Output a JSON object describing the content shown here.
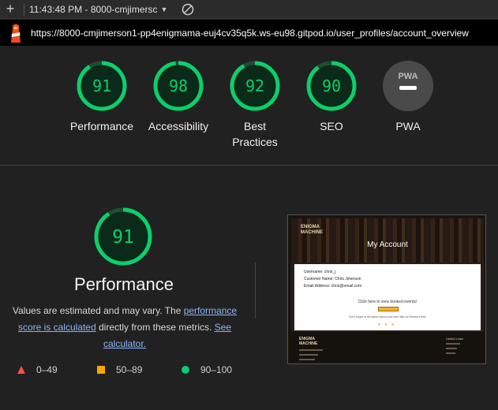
{
  "toolbar": {
    "add_label": "+",
    "time_label": "11:43:48 PM - 8000-cmjimersc"
  },
  "url_bar": {
    "url": "https://8000-cmjimerson1-pp4enigmama-euj4cv35q5k.ws-eu98.gitpod.io/user_profiles/account_overview"
  },
  "scores": [
    {
      "value": 91,
      "label": "Performance"
    },
    {
      "value": 98,
      "label": "Accessibility"
    },
    {
      "value": 92,
      "label": "Best Practices"
    },
    {
      "value": 90,
      "label": "SEO"
    }
  ],
  "pwa": {
    "badge": "PWA",
    "label": "PWA"
  },
  "performance": {
    "score": 91,
    "title": "Performance",
    "desc_prefix": "Values are estimated and may vary. The ",
    "desc_link1": "performance score is calculated",
    "desc_middle": " directly from these metrics. ",
    "desc_link2": "See calculator."
  },
  "legend": [
    {
      "range": "0–49",
      "shape": "triangle",
      "color": "#ff4e42"
    },
    {
      "range": "50–89",
      "shape": "square",
      "color": "#ffa400"
    },
    {
      "range": "90–100",
      "shape": "circle",
      "color": "#0cce6b"
    }
  ],
  "colors": {
    "pass": "#0cce6b",
    "pass_bg": "#0b2a1a",
    "gauge_track": "#1e4d33"
  },
  "thumbnail": {
    "brand": "ENIGMA MACHINE",
    "heading": "My Account",
    "username": "Username: chris_j",
    "customer_name": "Customer Name: Chris Jimerson",
    "email": "Email Address: chris@email.com",
    "booked_events": "Click here to view booked events!",
    "reminder": "Don't forget to tell others about your time with us! Review Here!",
    "footer_heading": "Useful Links"
  }
}
